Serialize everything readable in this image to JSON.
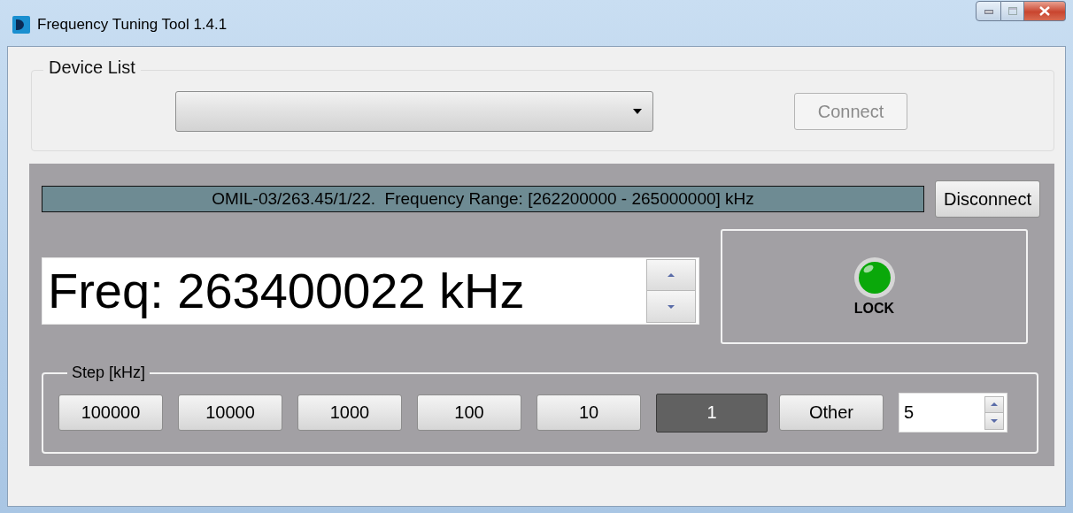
{
  "window": {
    "title": "Frequency Tuning Tool 1.4.1"
  },
  "device_list": {
    "label": "Device List",
    "connect_button": {
      "label": "Connect",
      "disabled": true
    }
  },
  "status": {
    "text": "OMIL-03/263.45/1/22.  Frequency Range: [262200000 - 265000000] kHz"
  },
  "disconnect_button": {
    "label": "Disconnect"
  },
  "frequency": {
    "value": "Freq: 263400022 kHz"
  },
  "lock": {
    "label": "LOCK",
    "on": true
  },
  "step": {
    "label": "Step [kHz]",
    "buttons": [
      {
        "label": "100000",
        "selected": false
      },
      {
        "label": "10000",
        "selected": false
      },
      {
        "label": "1000",
        "selected": false
      },
      {
        "label": "100",
        "selected": false
      },
      {
        "label": "10",
        "selected": false
      },
      {
        "label": "1",
        "selected": true
      },
      {
        "label": "Other",
        "selected": false
      }
    ],
    "other_value": "5"
  }
}
